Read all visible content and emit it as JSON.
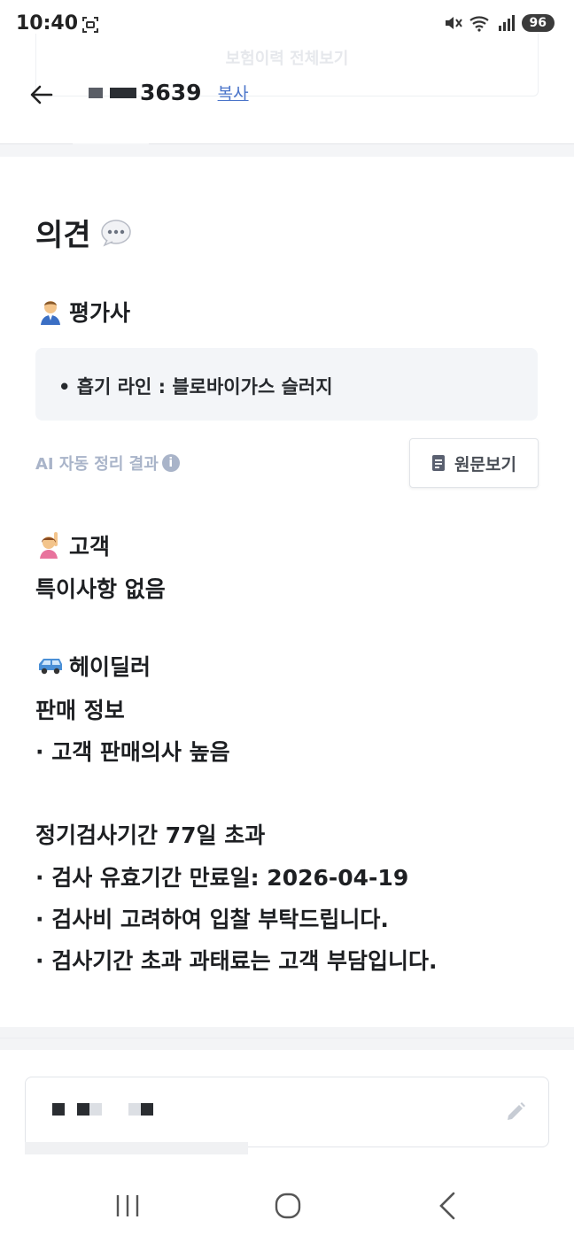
{
  "status_bar": {
    "time": "10:40",
    "battery": "96",
    "icons": [
      "screen-record-icon",
      "mute-icon",
      "wifi-icon",
      "signal-icon"
    ]
  },
  "header": {
    "ghost_button": "보험이력 전체보기",
    "plate_suffix": "3639",
    "copy_label": "복사"
  },
  "opinion": {
    "title": "의견",
    "appraiser": {
      "label": "평가사",
      "items": [
        "흡기 라인 : 블로바이가스 슬러지"
      ],
      "ai_note": "AI 자동 정리 결과",
      "view_original": "원문보기"
    },
    "customer": {
      "label": "고객",
      "text": "특이사항 없음"
    },
    "dealer": {
      "label": "헤이딜러",
      "lines": [
        "판매 정보",
        "· 고객 판매의사 높음",
        "정기검사기간 77일 초과",
        "· 검사 유효기간 만료일: 2026-04-19",
        "· 검사비 고려하여 입찰 부탁드립니다.",
        "· 검사기간 초과 과태료는 고객 부담입니다."
      ]
    }
  },
  "colors": {
    "accent_link": "#4a74c9",
    "ai_note": "#a9b4c9",
    "summary_bg": "#f3f5f8"
  }
}
